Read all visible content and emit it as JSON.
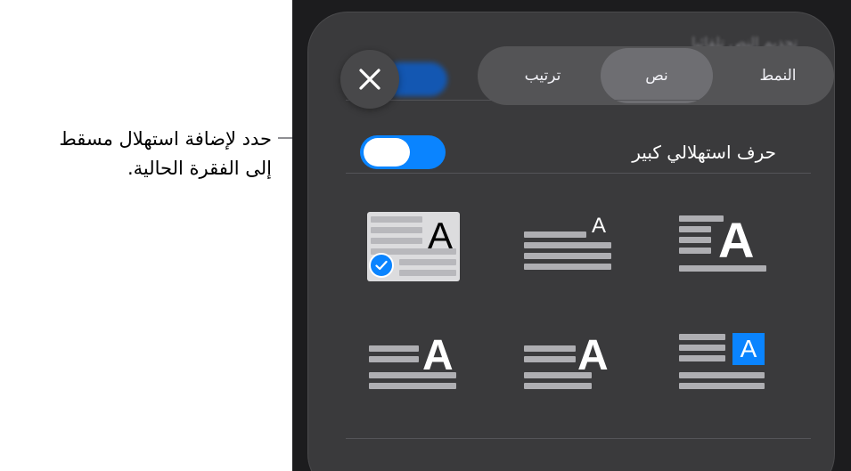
{
  "callout": {
    "line1": "حدد لإضافة استهلال مسقط",
    "line2": "إلى الفقرة الحالية."
  },
  "header": {
    "close_icon": "close-icon",
    "tabs": [
      {
        "label": "ترتيب",
        "active": false
      },
      {
        "label": "نص",
        "active": true
      },
      {
        "label": "النمط",
        "active": false
      }
    ],
    "ghost_text": "تحديم النص تلقائيا"
  },
  "drop_cap_row": {
    "label": "حرف استهلالي كبير",
    "toggle_on": true
  },
  "styles": {
    "letter": "A",
    "options": [
      {
        "name": "inset-box",
        "selected": true
      },
      {
        "name": "raised-small",
        "selected": false
      },
      {
        "name": "dropped-large",
        "selected": false
      },
      {
        "name": "dropped-right",
        "selected": false
      },
      {
        "name": "raised-right",
        "selected": false
      },
      {
        "name": "boxed-blue",
        "selected": false
      }
    ]
  },
  "colors": {
    "accent": "#0a84ff",
    "panel": "#3a3a3c",
    "background": "#1c1c1e"
  }
}
